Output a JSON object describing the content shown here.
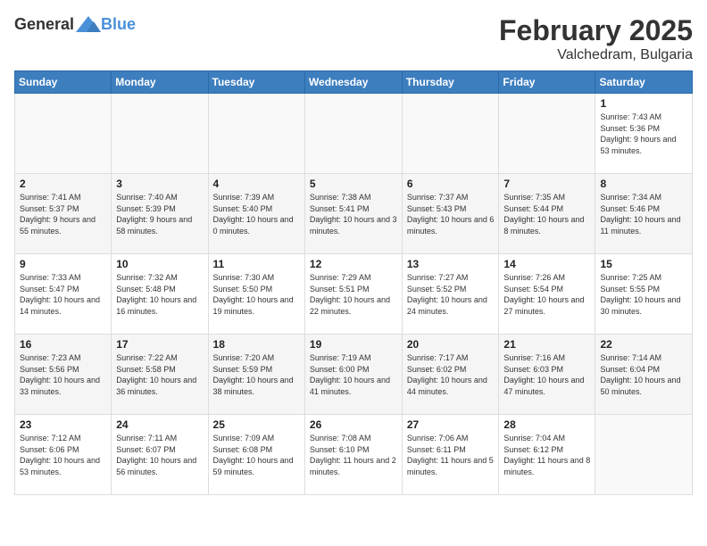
{
  "header": {
    "logo_general": "General",
    "logo_blue": "Blue",
    "month": "February 2025",
    "location": "Valchedram, Bulgaria"
  },
  "weekdays": [
    "Sunday",
    "Monday",
    "Tuesday",
    "Wednesday",
    "Thursday",
    "Friday",
    "Saturday"
  ],
  "weeks": [
    [
      {
        "day": "",
        "info": ""
      },
      {
        "day": "",
        "info": ""
      },
      {
        "day": "",
        "info": ""
      },
      {
        "day": "",
        "info": ""
      },
      {
        "day": "",
        "info": ""
      },
      {
        "day": "",
        "info": ""
      },
      {
        "day": "1",
        "info": "Sunrise: 7:43 AM\nSunset: 5:36 PM\nDaylight: 9 hours and 53 minutes."
      }
    ],
    [
      {
        "day": "2",
        "info": "Sunrise: 7:41 AM\nSunset: 5:37 PM\nDaylight: 9 hours and 55 minutes."
      },
      {
        "day": "3",
        "info": "Sunrise: 7:40 AM\nSunset: 5:39 PM\nDaylight: 9 hours and 58 minutes."
      },
      {
        "day": "4",
        "info": "Sunrise: 7:39 AM\nSunset: 5:40 PM\nDaylight: 10 hours and 0 minutes."
      },
      {
        "day": "5",
        "info": "Sunrise: 7:38 AM\nSunset: 5:41 PM\nDaylight: 10 hours and 3 minutes."
      },
      {
        "day": "6",
        "info": "Sunrise: 7:37 AM\nSunset: 5:43 PM\nDaylight: 10 hours and 6 minutes."
      },
      {
        "day": "7",
        "info": "Sunrise: 7:35 AM\nSunset: 5:44 PM\nDaylight: 10 hours and 8 minutes."
      },
      {
        "day": "8",
        "info": "Sunrise: 7:34 AM\nSunset: 5:46 PM\nDaylight: 10 hours and 11 minutes."
      }
    ],
    [
      {
        "day": "9",
        "info": "Sunrise: 7:33 AM\nSunset: 5:47 PM\nDaylight: 10 hours and 14 minutes."
      },
      {
        "day": "10",
        "info": "Sunrise: 7:32 AM\nSunset: 5:48 PM\nDaylight: 10 hours and 16 minutes."
      },
      {
        "day": "11",
        "info": "Sunrise: 7:30 AM\nSunset: 5:50 PM\nDaylight: 10 hours and 19 minutes."
      },
      {
        "day": "12",
        "info": "Sunrise: 7:29 AM\nSunset: 5:51 PM\nDaylight: 10 hours and 22 minutes."
      },
      {
        "day": "13",
        "info": "Sunrise: 7:27 AM\nSunset: 5:52 PM\nDaylight: 10 hours and 24 minutes."
      },
      {
        "day": "14",
        "info": "Sunrise: 7:26 AM\nSunset: 5:54 PM\nDaylight: 10 hours and 27 minutes."
      },
      {
        "day": "15",
        "info": "Sunrise: 7:25 AM\nSunset: 5:55 PM\nDaylight: 10 hours and 30 minutes."
      }
    ],
    [
      {
        "day": "16",
        "info": "Sunrise: 7:23 AM\nSunset: 5:56 PM\nDaylight: 10 hours and 33 minutes."
      },
      {
        "day": "17",
        "info": "Sunrise: 7:22 AM\nSunset: 5:58 PM\nDaylight: 10 hours and 36 minutes."
      },
      {
        "day": "18",
        "info": "Sunrise: 7:20 AM\nSunset: 5:59 PM\nDaylight: 10 hours and 38 minutes."
      },
      {
        "day": "19",
        "info": "Sunrise: 7:19 AM\nSunset: 6:00 PM\nDaylight: 10 hours and 41 minutes."
      },
      {
        "day": "20",
        "info": "Sunrise: 7:17 AM\nSunset: 6:02 PM\nDaylight: 10 hours and 44 minutes."
      },
      {
        "day": "21",
        "info": "Sunrise: 7:16 AM\nSunset: 6:03 PM\nDaylight: 10 hours and 47 minutes."
      },
      {
        "day": "22",
        "info": "Sunrise: 7:14 AM\nSunset: 6:04 PM\nDaylight: 10 hours and 50 minutes."
      }
    ],
    [
      {
        "day": "23",
        "info": "Sunrise: 7:12 AM\nSunset: 6:06 PM\nDaylight: 10 hours and 53 minutes."
      },
      {
        "day": "24",
        "info": "Sunrise: 7:11 AM\nSunset: 6:07 PM\nDaylight: 10 hours and 56 minutes."
      },
      {
        "day": "25",
        "info": "Sunrise: 7:09 AM\nSunset: 6:08 PM\nDaylight: 10 hours and 59 minutes."
      },
      {
        "day": "26",
        "info": "Sunrise: 7:08 AM\nSunset: 6:10 PM\nDaylight: 11 hours and 2 minutes."
      },
      {
        "day": "27",
        "info": "Sunrise: 7:06 AM\nSunset: 6:11 PM\nDaylight: 11 hours and 5 minutes."
      },
      {
        "day": "28",
        "info": "Sunrise: 7:04 AM\nSunset: 6:12 PM\nDaylight: 11 hours and 8 minutes."
      },
      {
        "day": "",
        "info": ""
      }
    ]
  ]
}
